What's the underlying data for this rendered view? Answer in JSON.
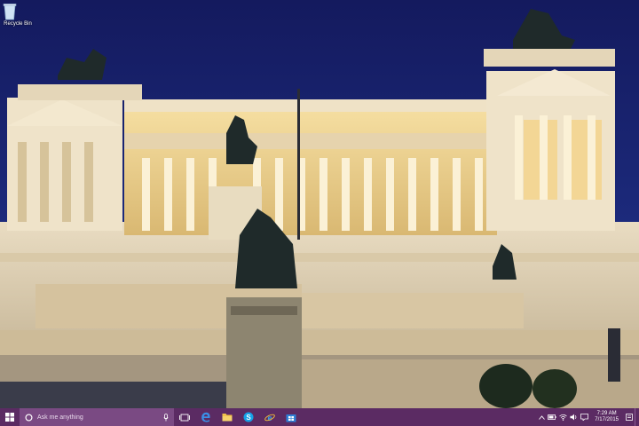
{
  "desktop": {
    "icons": [
      {
        "label": "Recycle Bin",
        "icon": "recycle-bin-icon"
      }
    ]
  },
  "taskbar": {
    "start_icon": "windows-start-icon",
    "search_placeholder": "Ask me anything",
    "search_icon": "cortana-circle-icon",
    "mic_icon": "microphone-icon",
    "pinned": [
      {
        "name": "task-view",
        "icon": "task-view-icon"
      },
      {
        "name": "edge",
        "icon": "edge-icon"
      },
      {
        "name": "file-explorer",
        "icon": "folder-icon"
      },
      {
        "name": "skype",
        "icon": "skype-icon"
      },
      {
        "name": "internet-explorer",
        "icon": "ie-icon"
      },
      {
        "name": "store",
        "icon": "store-icon"
      }
    ],
    "tray_icons": [
      "chevron-up-icon",
      "battery-icon",
      "network-icon",
      "volume-icon",
      "notification-icon"
    ],
    "clock": {
      "time": "7:29 AM",
      "date": "7/17/2015"
    }
  },
  "colors": {
    "taskbar": "#5b2b63",
    "search": "#7a4a83",
    "sky": "#1c2a7c"
  }
}
